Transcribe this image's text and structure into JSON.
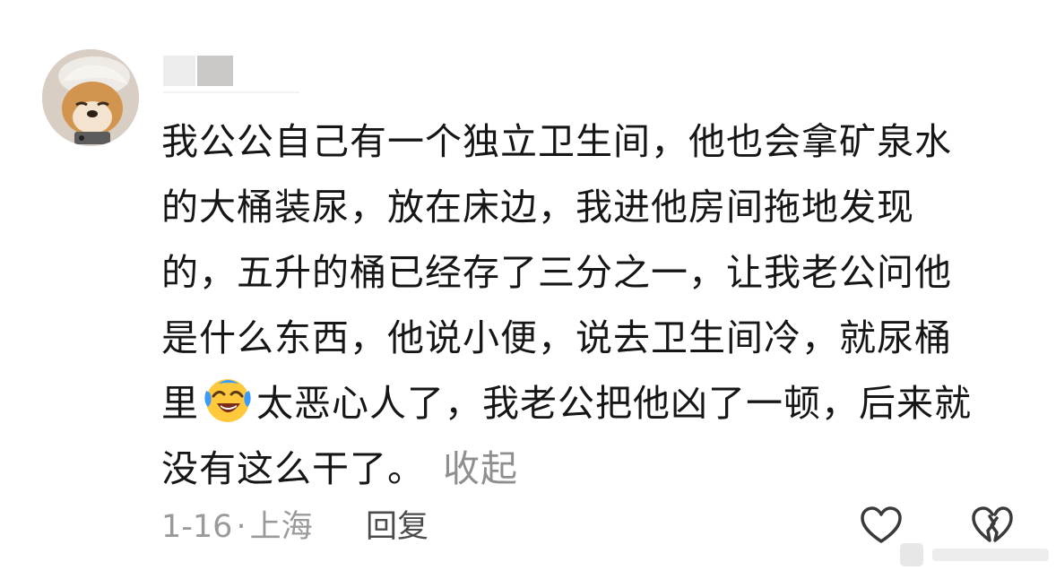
{
  "comment": {
    "avatar_icon": "shiba-dog-avatar-icon",
    "lines": [
      "我公公自己有一个独立卫生间，他也会拿矿泉水",
      "的大桶装尿，放在床边，我进他房间拖地发现",
      "的，五升的桶已经存了三分之一，让我老公问他",
      "是什么东西，他说小便，说去卫生间冷，就尿桶"
    ],
    "line5_before_emoji": "里",
    "emoji_icon": "laughing-crying-emoji-icon",
    "line5_after_emoji": "太恶心人了，我老公把他凶了一顿，后来就",
    "line6": "没有这么干了。",
    "collapse_label": "收起"
  },
  "meta": {
    "date": "1-16",
    "separator": "·",
    "location": "上海",
    "reply_label": "回复"
  },
  "actions": {
    "like_icon": "heart-like-icon",
    "dislike_icon": "broken-heart-dislike-icon"
  },
  "colors": {
    "text": "#161616",
    "muted": "#9a9a9a",
    "reply": "#4b4b4b",
    "emoji_yellow": "#ffc93b",
    "emoji_tear": "#3a9bff"
  }
}
